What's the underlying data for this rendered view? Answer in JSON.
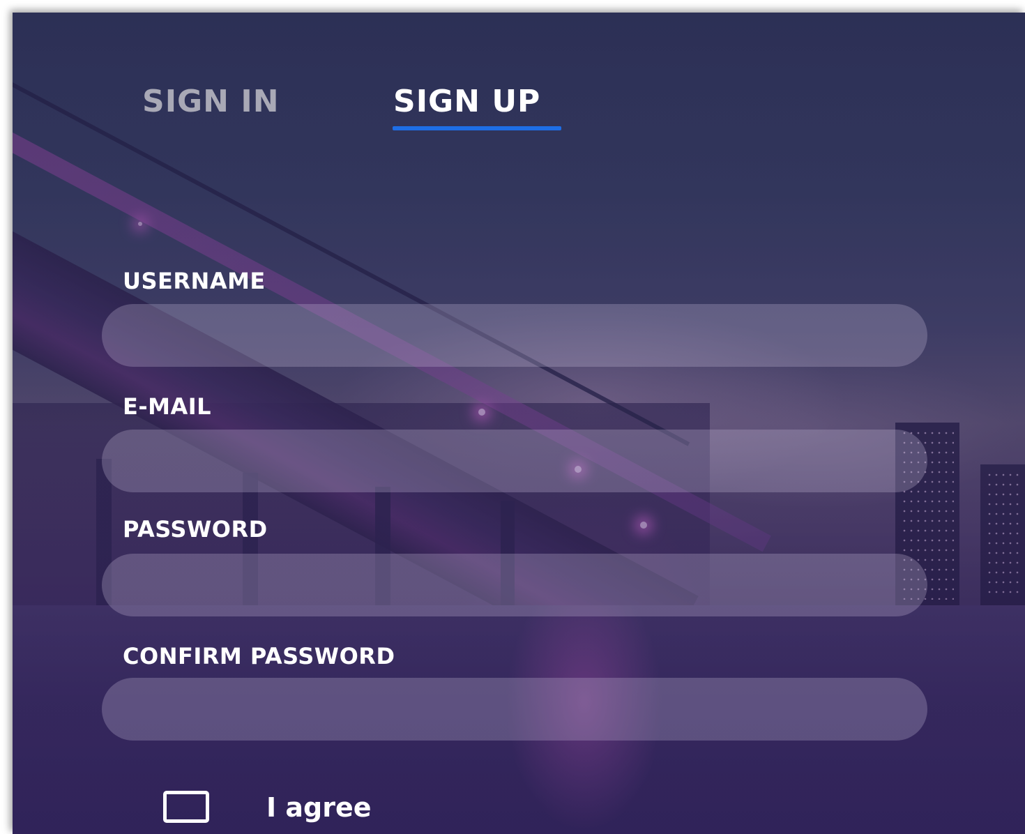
{
  "tabs": {
    "sign_in": "SIGN IN",
    "sign_up": "SIGN UP",
    "active": "SIGN UP",
    "active_color": "#ffffff",
    "inactive_color": "#a9a9b6",
    "underline_color": "#1e6ee6"
  },
  "form": {
    "username": {
      "label": "USERNAME",
      "value": "",
      "placeholder": ""
    },
    "email": {
      "label": "E-MAIL",
      "value": "",
      "placeholder": ""
    },
    "password": {
      "label": "PASSWORD",
      "value": "",
      "placeholder": ""
    },
    "confirm_password": {
      "label": "CONFIRM PASSWORD",
      "value": "",
      "placeholder": ""
    },
    "agree": {
      "label": "I agree",
      "checked": false
    }
  },
  "background": {
    "description_icon": "city-night-bridge-background"
  }
}
